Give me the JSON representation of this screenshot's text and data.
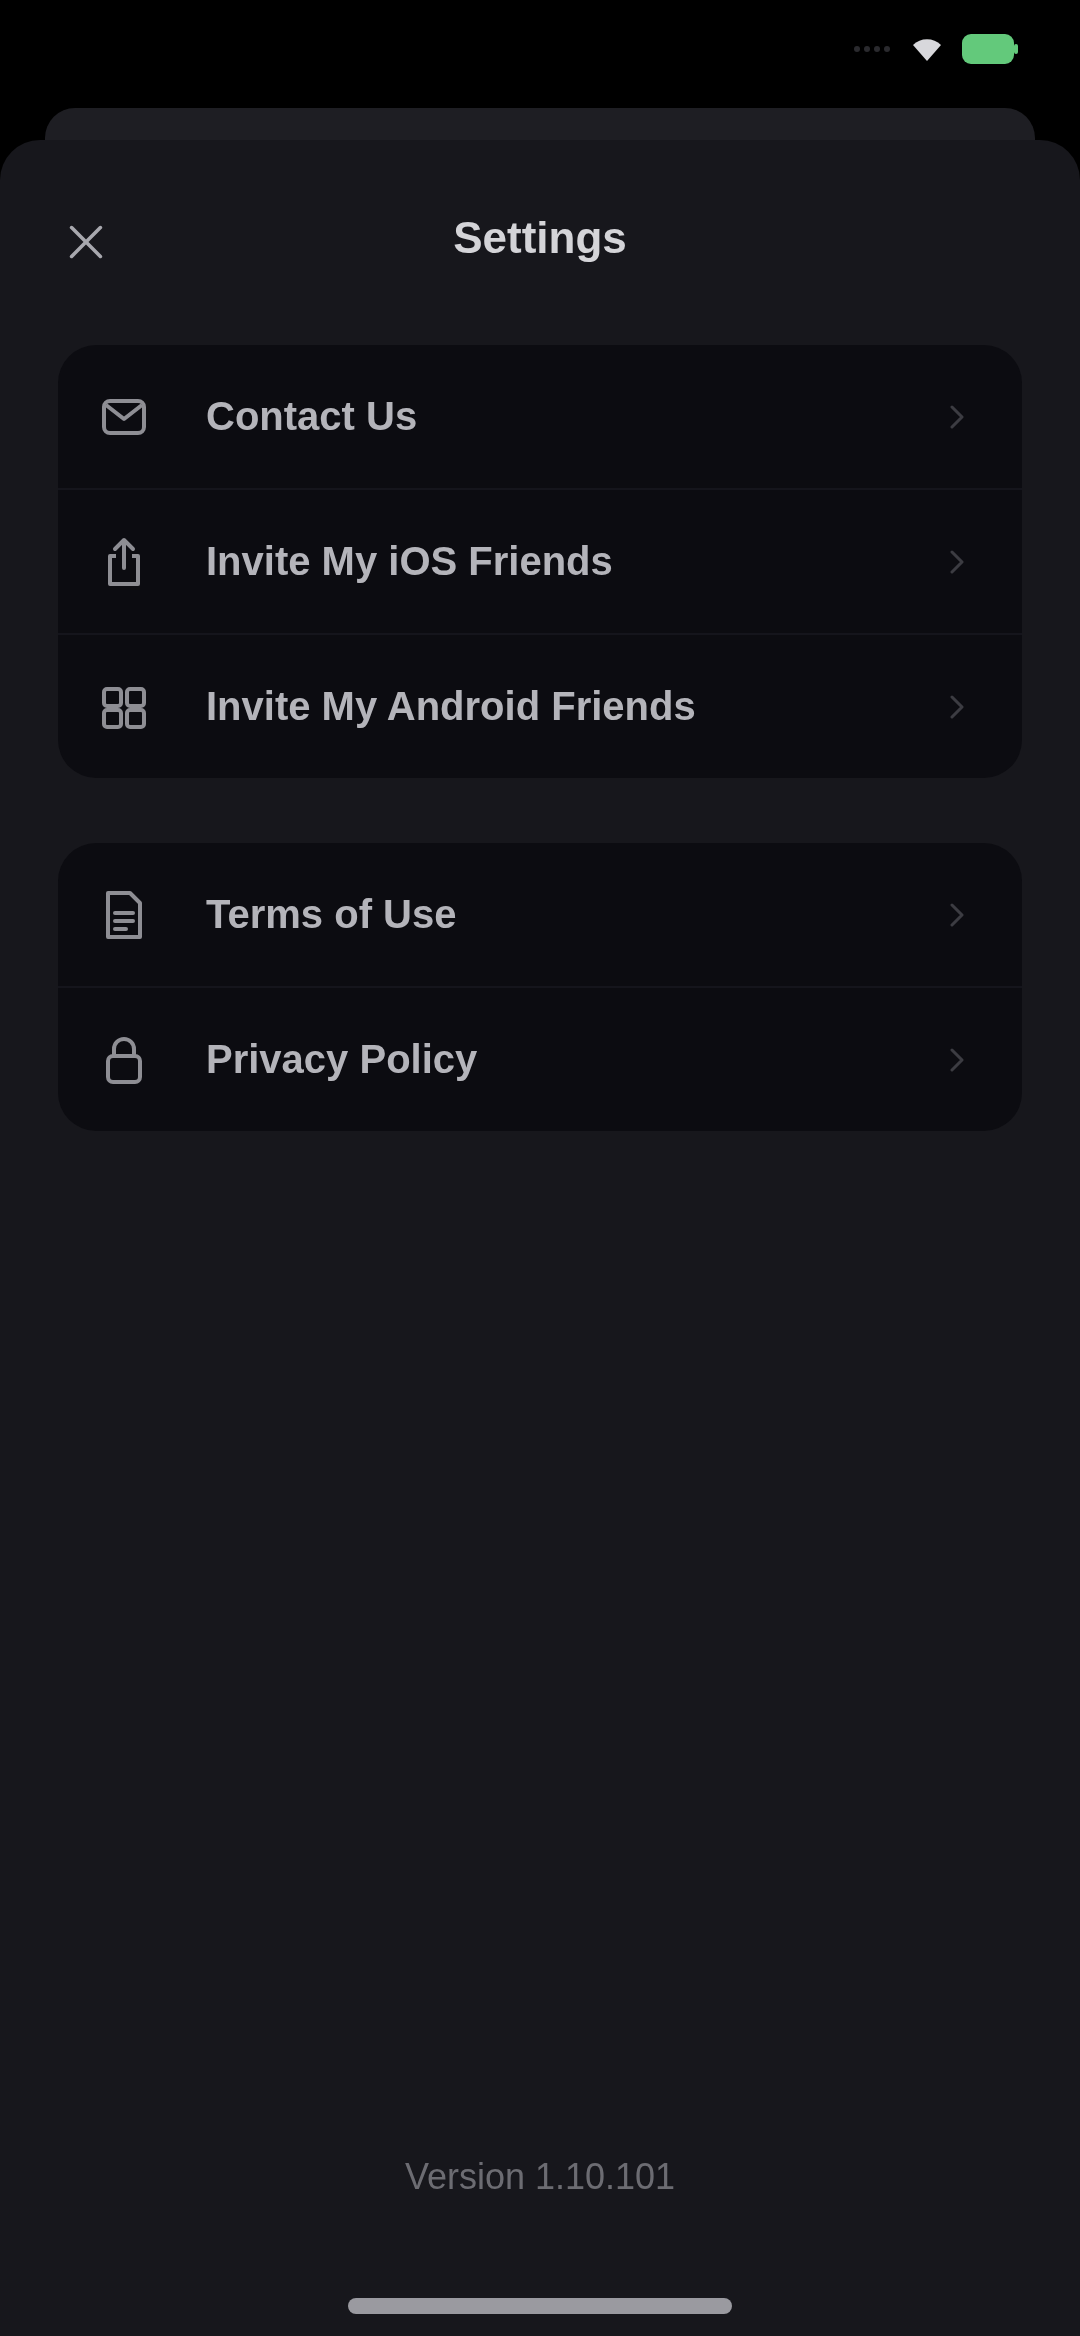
{
  "header": {
    "title": "Settings"
  },
  "groups": [
    {
      "items": [
        {
          "label": "Contact Us",
          "kind": "contact"
        },
        {
          "label": "Invite My iOS Friends",
          "kind": "ios"
        },
        {
          "label": "Invite My Android Friends",
          "kind": "android"
        }
      ]
    },
    {
      "items": [
        {
          "label": "Terms of Use",
          "kind": "terms"
        },
        {
          "label": "Privacy Policy",
          "kind": "privacy"
        }
      ]
    }
  ],
  "footer": {
    "version": "Version 1.10.101"
  }
}
